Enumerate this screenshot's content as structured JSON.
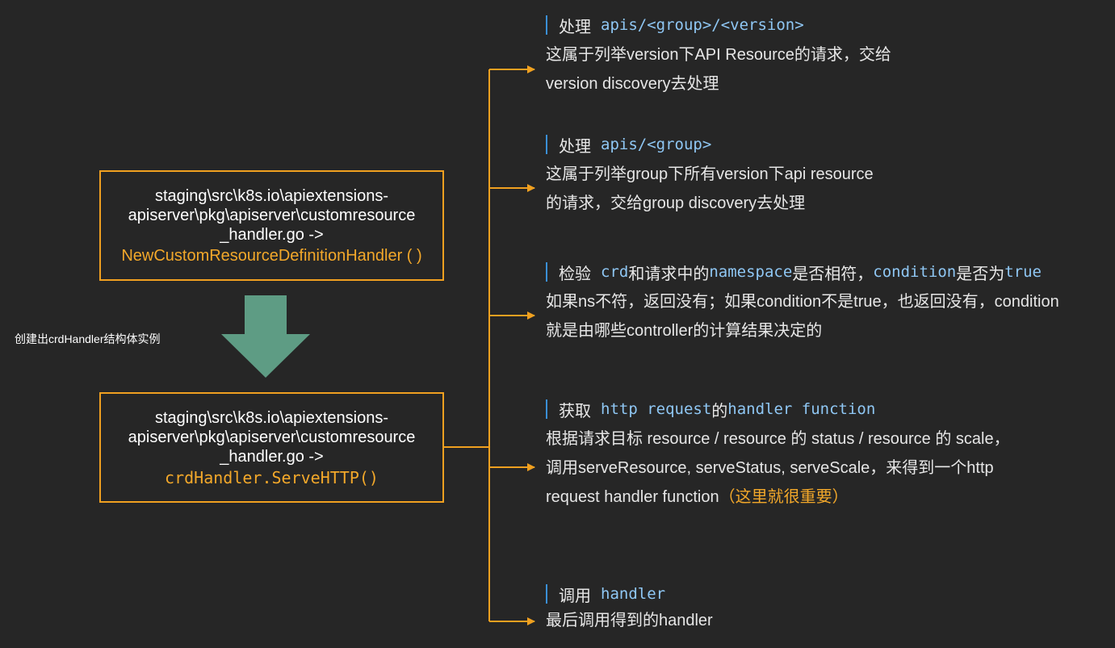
{
  "top_box": {
    "path_line1": "staging\\src\\k8s.io\\apiextensions-",
    "path_line2": "apiserver\\pkg\\apiserver\\customresource",
    "path_line3": "_handler.go ->",
    "func": "NewCustomResourceDefinitionHandler ( )"
  },
  "arrow_caption": "创建出crdHandler结构体实例",
  "bottom_box": {
    "path_line1": "staging\\src\\k8s.io\\apiextensions-",
    "path_line2": "apiserver\\pkg\\apiserver\\customresource",
    "path_line3": "_handler.go ->",
    "func": "crdHandler.ServeHTTP()"
  },
  "sections": [
    {
      "title_zh": "处理",
      "title_kw": "apis/<group>/<version>",
      "body": [
        "这属于列举version下API Resource的请求，交给",
        "version discovery去处理"
      ]
    },
    {
      "title_zh": "处理",
      "title_kw": "apis/<group>",
      "body": [
        "这属于列举group下所有version下api resource",
        "的请求，交给group discovery去处理"
      ]
    },
    {
      "title_zh": "检验",
      "title_kw": "crd",
      "title_zh2": "和请求中的",
      "title_kw2": "namespace",
      "title_zh3": "是否相符，",
      "title_kw3": "condition",
      "title_zh4": "是否为",
      "title_kw4": "true",
      "body": [
        "如果ns不符，返回没有；如果condition不是true，也返回没有，condition",
        "就是由哪些controller的计算结果决定的"
      ]
    },
    {
      "title_zh": "获取",
      "title_kw": "http request",
      "title_zh2": "的",
      "title_kw2": "handler function",
      "body": [
        "根据请求目标 resource / resource 的 status / resource 的 scale，",
        "调用serveResource, serveStatus, serveScale，来得到一个http",
        "request handler function"
      ],
      "note": "（这里就很重要）"
    },
    {
      "title_zh": "调用",
      "title_kw": "handler",
      "body": [
        "最后调用得到的handler"
      ]
    }
  ],
  "colors": {
    "background": "#262626",
    "box_border": "#f0a020",
    "connector": "#f0a020",
    "arrow_fill": "#5e9c84",
    "keyword": "#8fc7f4",
    "title_bar": "#3a8fd6"
  }
}
